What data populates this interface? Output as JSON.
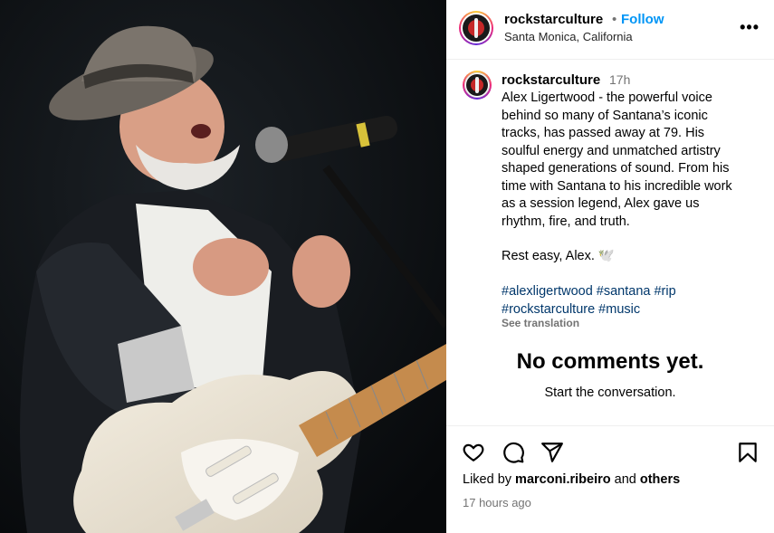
{
  "header": {
    "username": "rockstarculture",
    "separator": "•",
    "follow_label": "Follow",
    "location": "Santa Monica, California",
    "more_label": "•••"
  },
  "caption": {
    "username": "rockstarculture",
    "time": "17h",
    "lines": [
      "Alex Ligertwood - the powerful voice",
      "behind so many of Santana’s iconic",
      "tracks, has passed away at 79. His",
      "soulful energy and unmatched artistry",
      "shaped generations of sound. From his",
      "time with Santana to his incredible work",
      "as a session legend, Alex gave us",
      "rhythm, fire, and truth."
    ],
    "closing": "Rest easy, Alex. 🕊️",
    "hashtags_line1": "#alexligertwood #santana #rip",
    "hashtags_line2": "#rockstarculture #music",
    "see_translation": "See translation"
  },
  "comments": {
    "empty_title": "No comments yet.",
    "empty_subtitle": "Start the conversation."
  },
  "actions": {
    "icons": [
      "heart-icon",
      "comment-icon",
      "share-icon",
      "bookmark-icon"
    ],
    "liked_prefix": "Liked by ",
    "liked_user": "marconi.ribeiro",
    "liked_mid": " and ",
    "liked_suffix": "others",
    "timestamp": "17 hours ago"
  },
  "colors": {
    "link": "#0095f6",
    "hashtag": "#00376b",
    "muted": "#737373"
  }
}
